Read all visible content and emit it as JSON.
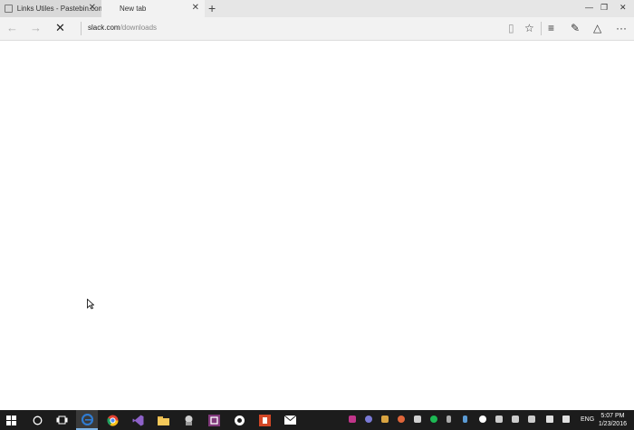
{
  "tabs": [
    {
      "label": "Links Utiles - Pastebin.com",
      "active": false
    },
    {
      "label": "New tab",
      "active": true
    }
  ],
  "window_controls": {
    "minimize": "—",
    "restore": "❐",
    "close": "✕"
  },
  "nav": {
    "back": "←",
    "forward": "→",
    "stop": "✕"
  },
  "address": {
    "host": "slack.com",
    "path": "/downloads"
  },
  "toolbar": {
    "reading_view": "▯",
    "favorite": "☆",
    "hub": "≡",
    "web_note": "✎",
    "share": "△",
    "more": "···"
  },
  "tab_close": "✕",
  "new_tab": "+",
  "taskbar": {
    "language": "ENG",
    "time": "5:07 PM",
    "date": "1/23/2016"
  },
  "colors": {
    "taskbar": "#1c1c1c",
    "edge_blue": "#2f7bd1",
    "accent": "#7fb4e6"
  }
}
